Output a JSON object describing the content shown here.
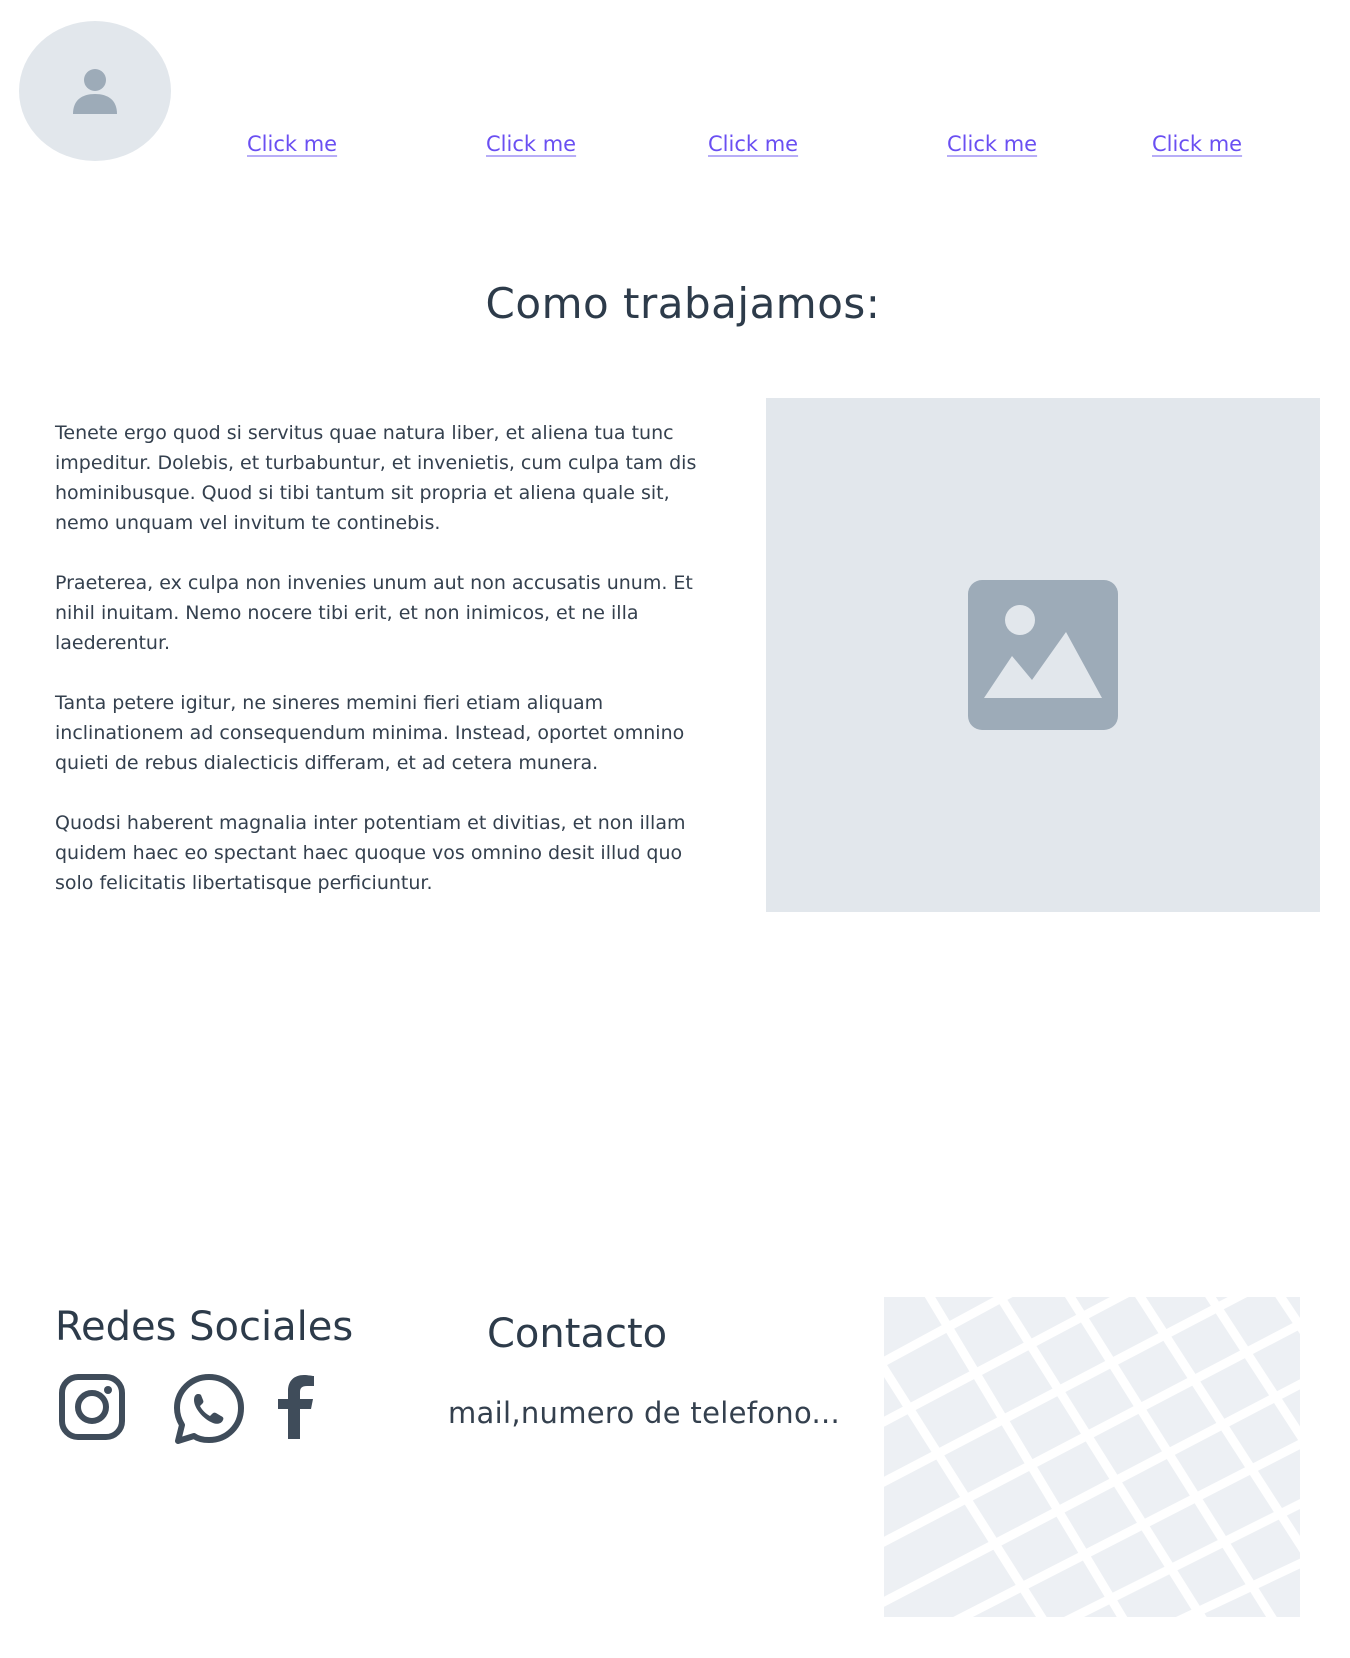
{
  "header": {
    "avatar_icon": "user-icon",
    "nav_links": [
      {
        "label": "Click me"
      },
      {
        "label": "Click me"
      },
      {
        "label": "Click me"
      },
      {
        "label": "Click me"
      },
      {
        "label": "Click me"
      }
    ]
  },
  "main": {
    "title": "Como trabajamos:",
    "paragraphs": [
      "Tenete ergo quod si servitus quae natura liber, et aliena tua tunc impeditur. Dolebis, et turbabuntur, et invenietis, cum culpa tam dis hominibusque. Quod si tibi tantum sit propria et aliena quale sit, nemo unquam vel invitum te continebis.",
      "Praeterea, ex culpa non invenies unum aut non accusatis unum. Et nihil inuitam. Nemo nocere tibi erit, et non inimicos, et ne illa laederentur.",
      "Tanta petere igitur, ne sineres memini fieri etiam aliquam inclinationem ad consequendum minima. Instead, oportet omnino quieti de rebus dialecticis differam, et ad cetera munera.",
      "Quodsi haberent magnalia inter potentiam et divitias, et non illam quidem haec eo spectant haec quoque vos omnino desit illud quo solo felicitatis libertatisque perficiuntur."
    ],
    "image_icon": "image-placeholder-icon"
  },
  "footer": {
    "social_title": "Redes Sociales",
    "social_icons": [
      "instagram-icon",
      "whatsapp-icon",
      "facebook-icon"
    ],
    "contact_title": "Contacto",
    "contact_text": "mail,numero de telefono..."
  },
  "colors": {
    "link": "#6a4ff2",
    "text": "#2d3b4a",
    "placeholder_bg": "#e2e7ec",
    "placeholder_icon": "#9dabb8",
    "map_bg": "#edf0f4"
  }
}
